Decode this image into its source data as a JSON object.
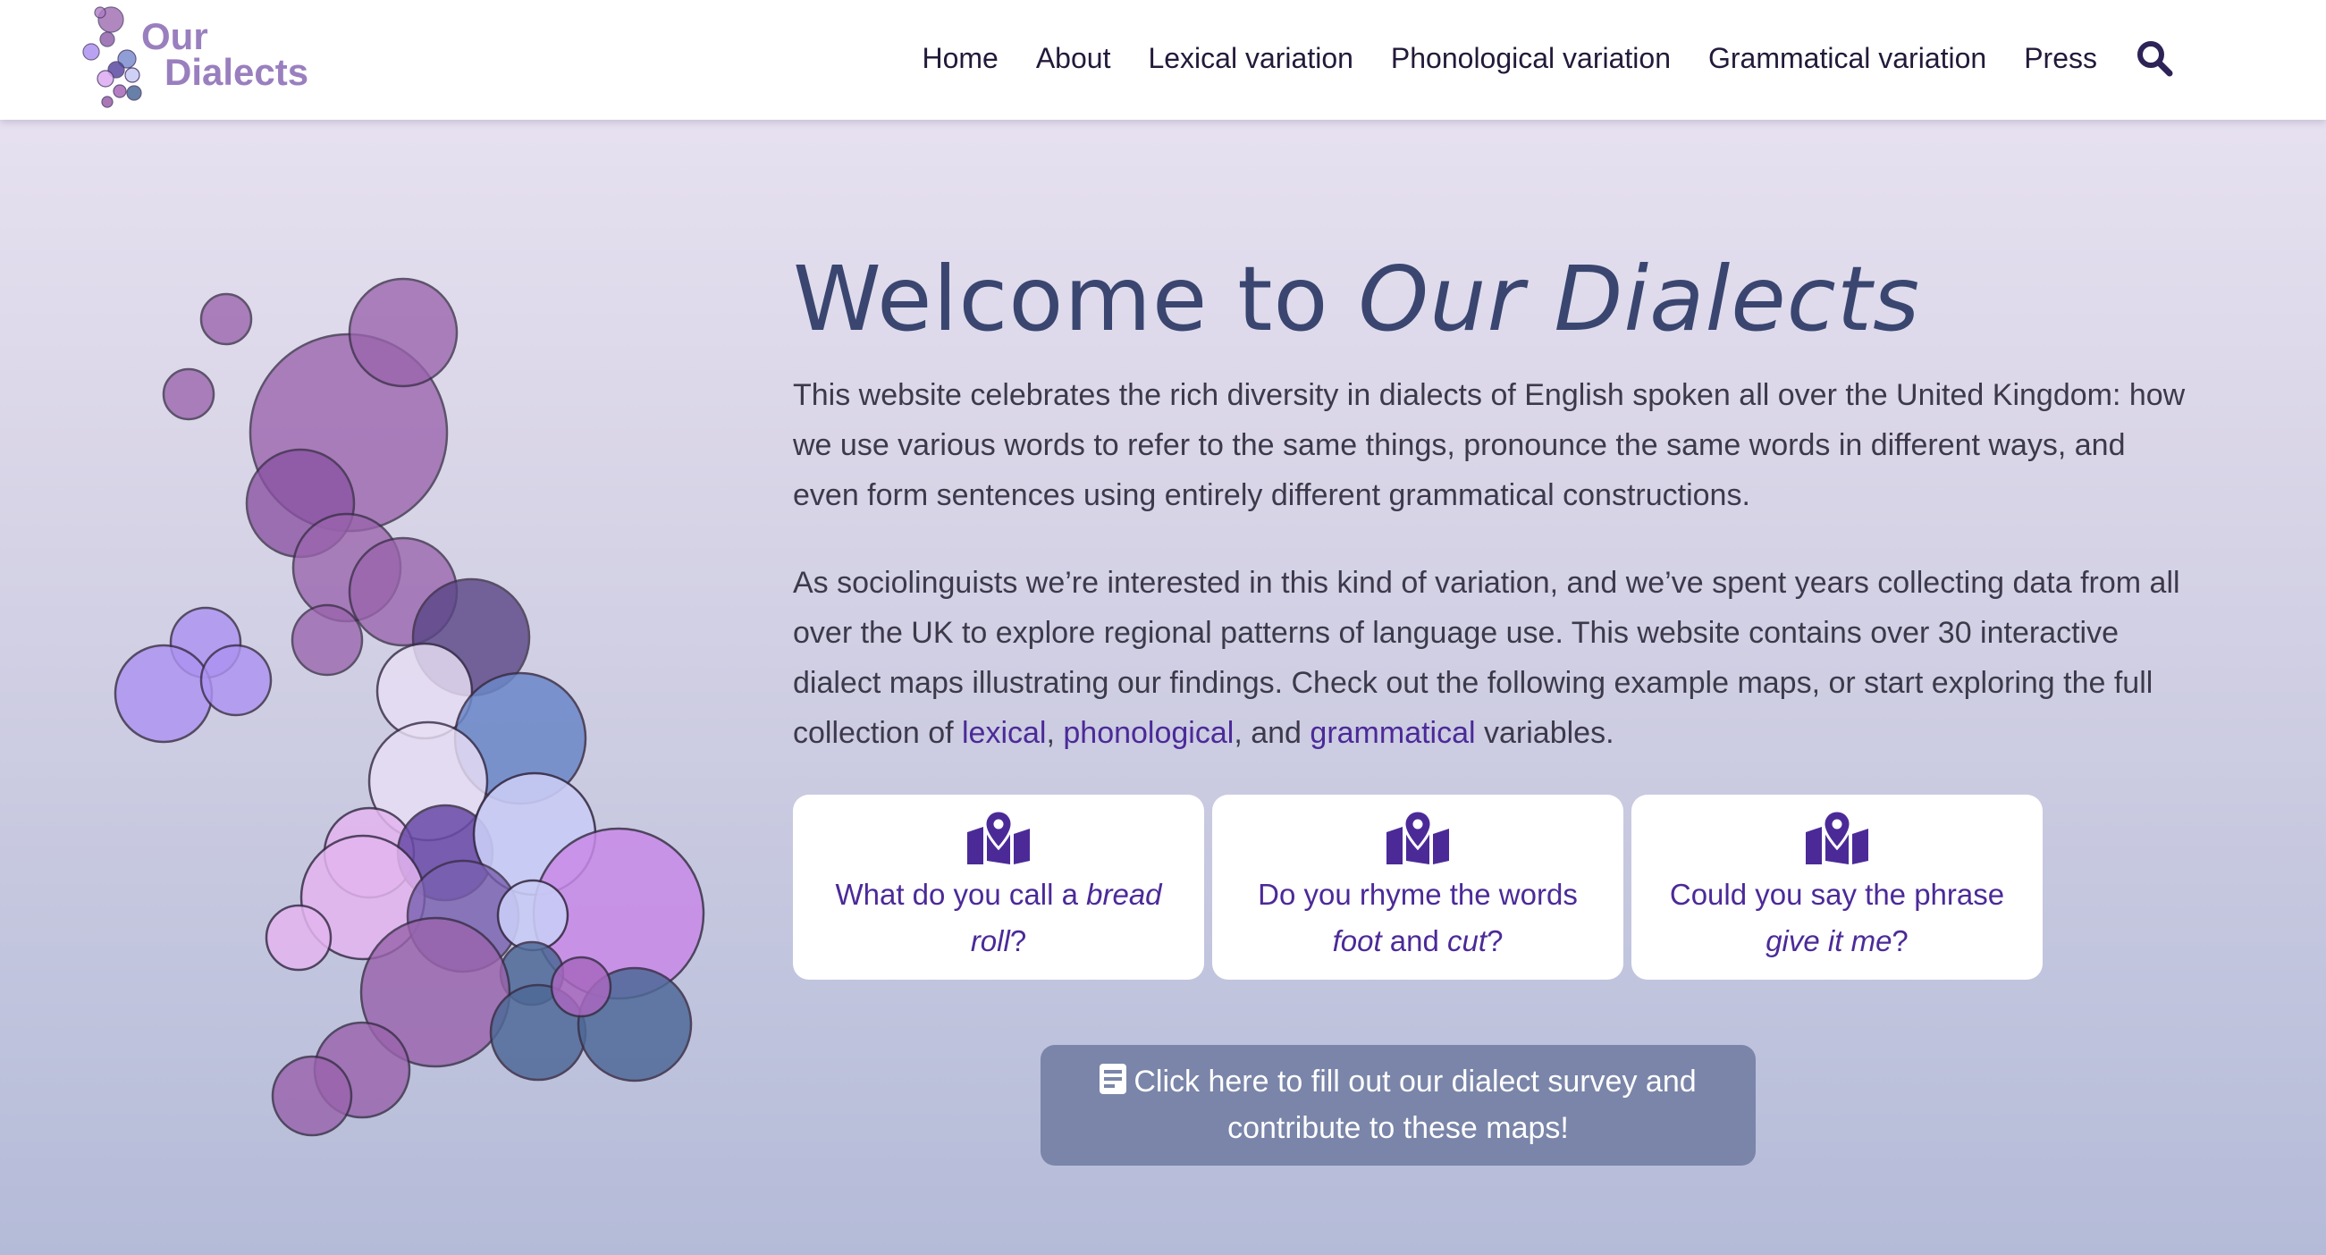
{
  "logo": {
    "line1": "Our",
    "line2": "Dialects"
  },
  "nav": {
    "items": [
      "Home",
      "About",
      "Lexical variation",
      "Phonological variation",
      "Grammatical variation",
      "Press"
    ],
    "search_icon": "search-icon"
  },
  "hero": {
    "title_plain": "Welcome to ",
    "title_italic": "Our Dialects",
    "paragraph1": "This website celebrates the rich diversity in dialects of English spoken all over the United Kingdom: how we use various words to refer to the same things, pronounce the same words in different ways, and even form sentences using entirely different grammatical constructions.",
    "paragraph2_start": "As sociolinguists we’re interested in this kind of variation, and we’ve spent years collecting data from all over the UK to explore regional patterns of language use. This website contains over 30 interactive dialect maps illustrating our findings. Check out the following example maps, or start exploring the full collection of ",
    "link_lexical": "lexical",
    "sep1": ", ",
    "link_phonological": "phonological",
    "sep2": ", and ",
    "link_grammatical": "grammatical",
    "paragraph2_end": " variables."
  },
  "cards": [
    {
      "icon": "map-marker-icon",
      "text_before": "What do you call a ",
      "text_italic": "bread roll",
      "text_after": "?"
    },
    {
      "icon": "map-marker-icon",
      "text_before": "Do you rhyme the words ",
      "text_italic": "foot",
      "text_middle": " and ",
      "text_italic2": "cut",
      "text_after": "?"
    },
    {
      "icon": "map-marker-icon",
      "text_before": "Could you say the phrase ",
      "text_italic": "give it me",
      "text_after": "?"
    }
  ],
  "survey": {
    "icon": "form-icon",
    "label": "Click here to fill out our dialect survey and contribute to these maps!"
  },
  "colors": {
    "accent": "#4b2a98",
    "title": "#3a4670",
    "survey_button": "#7a85a9",
    "logo": "#9a7fbf"
  }
}
